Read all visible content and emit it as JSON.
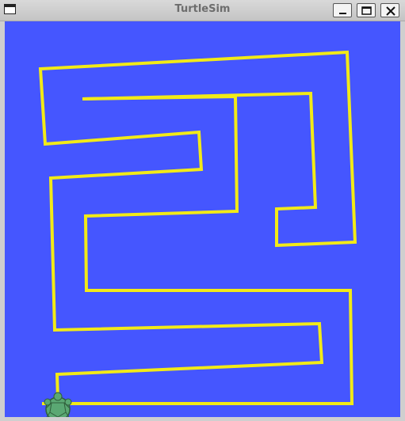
{
  "window": {
    "title": "TurtleSim",
    "controls": [
      "minimize",
      "maximize",
      "close"
    ],
    "menu_icon": "window-menu-icon"
  },
  "canvas": {
    "background": "#4556ff",
    "path_color": "#f2ea17",
    "turtle_color": "#5aa873"
  }
}
